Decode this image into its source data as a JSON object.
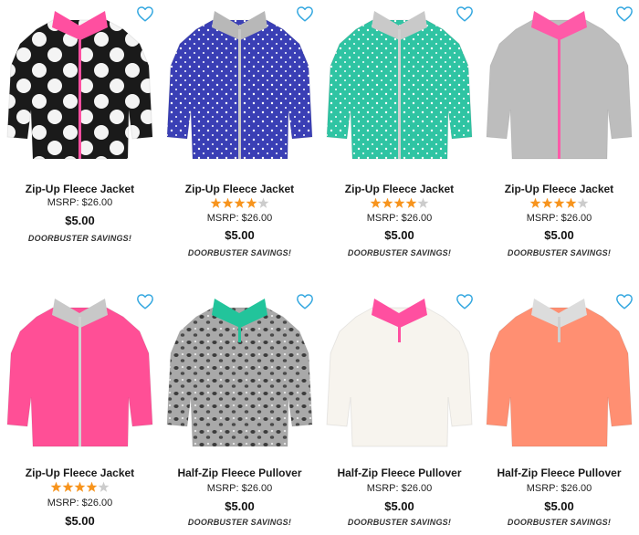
{
  "accent_heart": "#35a8e0",
  "star_color": "#f7941d",
  "star_empty": "#cccccc",
  "products": [
    {
      "title": "Zip-Up Fleece Jacket",
      "msrp": "MSRP: $26.00",
      "price": "$5.00",
      "promo": "DOORBUSTER SAVINGS!",
      "rating": null,
      "style": "jacket",
      "body_color": "#1a1a1a",
      "trim_color": "#ff4fa0",
      "zip_color": "#ff4fa0",
      "pattern": "dots-white"
    },
    {
      "title": "Zip-Up Fleece Jacket",
      "msrp": "MSRP: $26.00",
      "price": "$5.00",
      "promo": "DOORBUSTER SAVINGS!",
      "rating": 4,
      "style": "jacket",
      "body_color": "#3a3fb5",
      "trim_color": "#b8b8b8",
      "zip_color": "#c8c8c8",
      "pattern": "tiny-white"
    },
    {
      "title": "Zip-Up Fleece Jacket",
      "msrp": "MSRP: $26.00",
      "price": "$5.00",
      "promo": "DOORBUSTER SAVINGS!",
      "rating": 4,
      "style": "jacket",
      "body_color": "#2fc4a3",
      "trim_color": "#c9c9c9",
      "zip_color": "#d0d0d0",
      "pattern": "tiny-white"
    },
    {
      "title": "Zip-Up Fleece Jacket",
      "msrp": "MSRP: $26.00",
      "price": "$5.00",
      "promo": "DOORBUSTER SAVINGS!",
      "rating": 4,
      "style": "jacket",
      "body_color": "#bdbdbd",
      "trim_color": "#ff5aa8",
      "zip_color": "#ff5aa8",
      "pattern": "none"
    },
    {
      "title": "Zip-Up Fleece Jacket",
      "msrp": "MSRP: $26.00",
      "price": "$5.00",
      "promo": "",
      "rating": 4,
      "style": "jacket",
      "body_color": "#ff4f96",
      "trim_color": "#c8c8c8",
      "zip_color": "#d0d0d0",
      "pattern": "none"
    },
    {
      "title": "Half-Zip Fleece Pullover",
      "msrp": "MSRP: $26.00",
      "price": "$5.00",
      "promo": "DOORBUSTER SAVINGS!",
      "rating": null,
      "style": "pullover",
      "body_color": "#8f8f8f",
      "trim_color": "#22c49b",
      "zip_color": "#22c49b",
      "pattern": "leopard"
    },
    {
      "title": "Half-Zip Fleece Pullover",
      "msrp": "MSRP: $26.00",
      "price": "$5.00",
      "promo": "DOORBUSTER SAVINGS!",
      "rating": null,
      "style": "pullover",
      "body_color": "#f7f4ee",
      "trim_color": "#ff4fa0",
      "zip_color": "#ff4fa0",
      "pattern": "none"
    },
    {
      "title": "Half-Zip Fleece Pullover",
      "msrp": "MSRP: $26.00",
      "price": "$5.00",
      "promo": "DOORBUSTER SAVINGS!",
      "rating": null,
      "style": "pullover",
      "body_color": "#ff8f72",
      "trim_color": "#dcdcdc",
      "zip_color": "#cfcfcf",
      "pattern": "none"
    }
  ]
}
